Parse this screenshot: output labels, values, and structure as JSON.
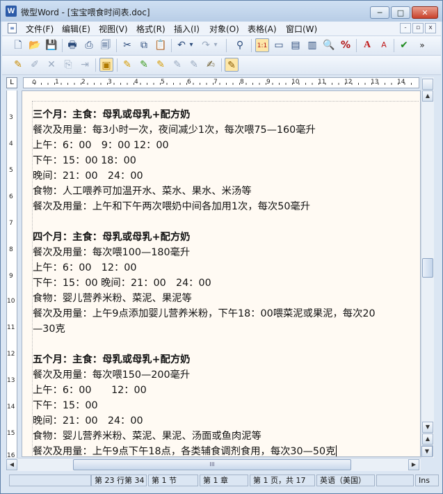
{
  "window": {
    "title": "微型Word - [宝宝喂食时间表.doc]",
    "app_icon": "W"
  },
  "window_buttons": {
    "minimize": "─",
    "maximize": "□",
    "close": "✕"
  },
  "menubar": {
    "items": [
      "文件(F)",
      "编辑(E)",
      "视图(V)",
      "格式(R)",
      "插入(I)",
      "对象(O)",
      "表格(A)",
      "窗口(W)"
    ],
    "mdi_buttons": [
      "-",
      "▫",
      "x"
    ]
  },
  "toolbar1": [
    {
      "icon": "new-document-icon",
      "glyph": "🗋"
    },
    {
      "icon": "open-folder-icon",
      "glyph": "📂"
    },
    {
      "icon": "save-icon",
      "glyph": "💾"
    },
    {
      "icon": "print-icon",
      "glyph": "🖶"
    },
    {
      "icon": "pdf-export-icon",
      "glyph": "⎙"
    },
    {
      "icon": "print-preview-icon",
      "glyph": "🗐"
    },
    {
      "icon": "cut-icon",
      "glyph": "✂"
    },
    {
      "icon": "copy-icon",
      "glyph": "⧉"
    },
    {
      "icon": "paste-icon",
      "glyph": "📋"
    },
    {
      "icon": "undo-icon",
      "glyph": "↶"
    },
    {
      "icon": "undo-dropdown-icon",
      "glyph": "▾"
    },
    {
      "icon": "redo-icon",
      "glyph": "↷"
    },
    {
      "icon": "redo-dropdown-icon",
      "glyph": "▾"
    },
    {
      "icon": "find-binoculars-icon",
      "glyph": "⚲"
    },
    {
      "icon": "actual-size-icon",
      "glyph": "1:1"
    },
    {
      "icon": "page-width-icon",
      "glyph": "▭"
    },
    {
      "icon": "whole-page-icon",
      "glyph": "▤"
    },
    {
      "icon": "two-pages-icon",
      "glyph": "▥"
    },
    {
      "icon": "zoom-icon",
      "glyph": "🔍"
    },
    {
      "icon": "zoom-percent-icon",
      "glyph": "%"
    },
    {
      "icon": "font-color-icon",
      "glyph": "A"
    },
    {
      "icon": "format-text-icon",
      "glyph": "A"
    },
    {
      "icon": "spell-check-icon",
      "glyph": "✔"
    },
    {
      "icon": "more-tools-icon",
      "glyph": "»"
    }
  ],
  "toolbar2": [
    {
      "icon": "insert-doc-icon",
      "glyph": "✎"
    },
    {
      "icon": "edit-doc-icon",
      "glyph": "✐"
    },
    {
      "icon": "delete-doc-icon",
      "glyph": "✕"
    },
    {
      "icon": "doc-copy-icon",
      "glyph": "⎘"
    },
    {
      "icon": "doc-move-icon",
      "glyph": "⇥"
    },
    {
      "icon": "track-changes-icon",
      "glyph": "▣"
    },
    {
      "icon": "highlight-marker-icon",
      "glyph": "✎"
    },
    {
      "icon": "marker-green-icon",
      "glyph": "✎"
    },
    {
      "icon": "marker-yellow-icon",
      "glyph": "✎"
    },
    {
      "icon": "marker-eraser-icon",
      "glyph": "✎"
    },
    {
      "icon": "marker-clear-icon",
      "glyph": "✎"
    },
    {
      "icon": "note-icon",
      "glyph": "✍"
    },
    {
      "icon": "annotation-icon",
      "glyph": "✎"
    }
  ],
  "ruler": {
    "corner": "L",
    "numbers": [
      "1",
      "2",
      "3",
      "4",
      "5",
      "6",
      "7",
      "8",
      "9",
      "10",
      "11",
      "12",
      "13",
      "14"
    ],
    "vertical_numbers": [
      "3",
      "4",
      "5",
      "6",
      "7",
      "8",
      "9",
      "10",
      "11",
      "12",
      "13",
      "14",
      "15",
      "16"
    ]
  },
  "document": {
    "lines": [
      {
        "text": "三个月：主食：母乳或母乳+配方奶",
        "bold": true
      },
      {
        "text": "餐次及用量：每3小时一次，夜间减少1次，每次喂75—160毫升",
        "bold": false
      },
      {
        "text": "上午：6：00　9：00  12：00",
        "bold": false
      },
      {
        "text": "下午：15：00  18：00",
        "bold": false
      },
      {
        "text": "晚间：21：00　24：00",
        "bold": false
      },
      {
        "text": "食物：人工喂养可加温开水、菜水、果水、米汤等",
        "bold": false
      },
      {
        "text": "餐次及用量：上午和下午两次喂奶中间各加用1次，每次50毫升",
        "bold": false
      },
      {
        "text": "",
        "bold": false
      },
      {
        "text": "四个月：主食：母乳或母乳+配方奶",
        "bold": true
      },
      {
        "text": "餐次及用量：每次喂100—180毫升",
        "bold": false
      },
      {
        "text": "上午：6：00　12：00",
        "bold": false
      },
      {
        "text": "下午：15：00  晚间：21：00　24：00",
        "bold": false
      },
      {
        "text": "食物：婴儿营养米粉、菜泥、果泥等",
        "bold": false
      },
      {
        "text": "餐次及用量：上午9点添加婴儿营养米粉，下午18：00喂菜泥或果泥，每次20",
        "bold": false
      },
      {
        "text": "—30克",
        "bold": false
      },
      {
        "text": "",
        "bold": false
      },
      {
        "text": "五个月：主食：母乳或母乳+配方奶",
        "bold": true
      },
      {
        "text": "餐次及用量：每次喂150—200毫升",
        "bold": false
      },
      {
        "text": "上午：6：00　　12：00",
        "bold": false
      },
      {
        "text": "下午：15：00",
        "bold": false
      },
      {
        "text": "晚间：21：00　24：00",
        "bold": false
      },
      {
        "text": "食物：婴儿营养米粉、菜泥、果泥、汤面或鱼肉泥等",
        "bold": false
      },
      {
        "text": "餐次及用量：上午9点下午18点，各类辅食调剂食用，每次30—50克",
        "bold": false
      }
    ]
  },
  "scrollbar": {
    "up": "▲",
    "down": "▼",
    "prev_page": "▲",
    "select_browse": "●",
    "next_page": "▼",
    "left": "◀",
    "right": "▶",
    "grip": "III"
  },
  "status": {
    "position": "第 23 行第 34",
    "section": "第 1 节",
    "chapter": "第 1 章",
    "page": "第 1 页，共 17",
    "language": "英语（美国）",
    "mode": "Ins"
  },
  "colors": {
    "page_bg": "#fffaf3",
    "chrome": "#dbe6f3",
    "accent": "#2c5ba8"
  }
}
